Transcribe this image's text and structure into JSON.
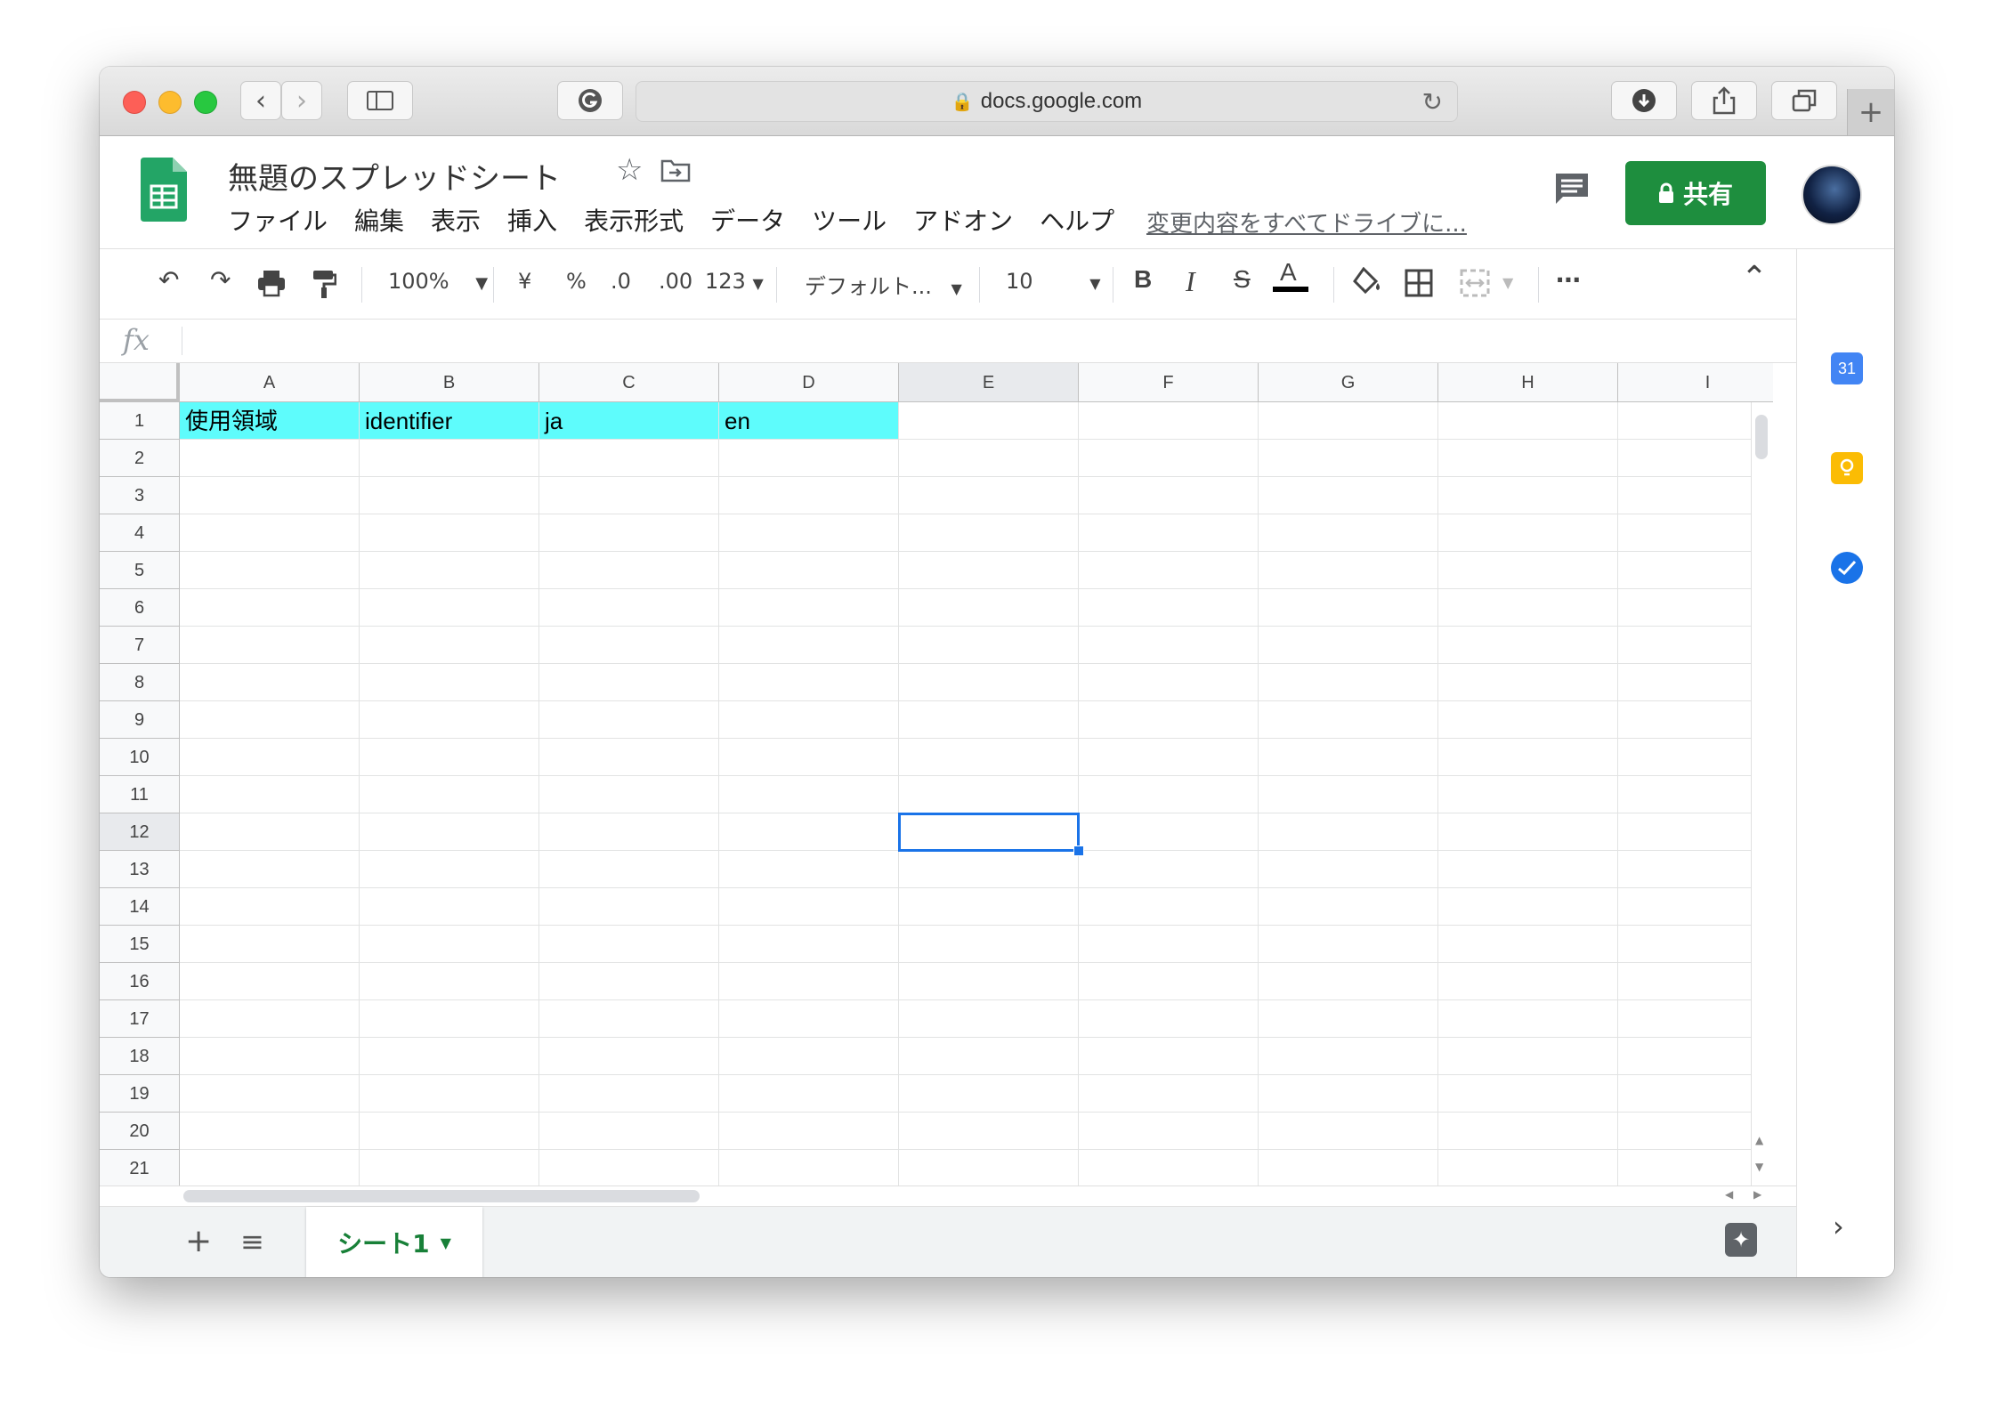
{
  "browser": {
    "url": "docs.google.com"
  },
  "doc": {
    "title": "無題のスプレッドシート",
    "saved_status": "変更内容をすべてドライブに..."
  },
  "menu": [
    "ファイル",
    "編集",
    "表示",
    "挿入",
    "表示形式",
    "データ",
    "ツール",
    "アドオン",
    "ヘルプ"
  ],
  "share": {
    "label": "共有"
  },
  "toolbar": {
    "zoom": "100%",
    "currency": "¥",
    "percent": "%",
    "dec_decrease": ".0",
    "dec_increase": ".00",
    "format_more": "123",
    "font": "デフォルト...",
    "font_size": "10",
    "bold": "B",
    "italic": "I",
    "strike": "S",
    "text_color": "A"
  },
  "formula_bar": {
    "label": "fx",
    "value": ""
  },
  "grid": {
    "columns": [
      "A",
      "B",
      "C",
      "D",
      "E",
      "F",
      "G",
      "H",
      "I"
    ],
    "rows": [
      "1",
      "2",
      "3",
      "4",
      "5",
      "6",
      "7",
      "8",
      "9",
      "10",
      "11",
      "12",
      "13",
      "14",
      "15",
      "16",
      "17",
      "18",
      "19",
      "20",
      "21"
    ],
    "active_column": "E",
    "active_row": "12",
    "header_row": [
      "使用領域",
      "identifier",
      "ja",
      "en"
    ],
    "header_fill_color": "#5efcfc"
  },
  "sheets": {
    "tabs": [
      "シート1"
    ],
    "add_label": "+"
  },
  "side_panel": {
    "calendar_label": "31"
  },
  "colors": {
    "share_button": "#1e8e3e",
    "selection": "#1a73e8",
    "sheet_tab_text": "#188038"
  }
}
